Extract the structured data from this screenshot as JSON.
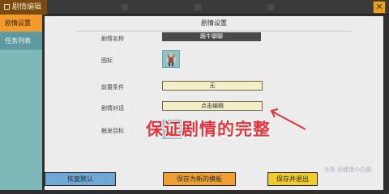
{
  "window": {
    "title": "剧情编辑",
    "close_label": "✕"
  },
  "sidebar": {
    "items": [
      {
        "label": "剧情设置",
        "active": true
      },
      {
        "label": "任务列表",
        "active": false
      }
    ]
  },
  "panel": {
    "header": "剧情设置",
    "fields": {
      "name_label": "剧情名称",
      "name_value": "跟牛聊聊",
      "icon_label": "图标",
      "precondition_label": "前置条件",
      "precondition_value": "无",
      "dialog_label": "剧情对话",
      "dialog_value": "点击编辑",
      "trigger_label": "触发目标",
      "add_symbol": "+"
    },
    "buttons": {
      "reset": "恢复默认",
      "save_template": "保存为新的模板",
      "save_exit": "保存并退出"
    }
  },
  "annotation": "保证剧情的完整",
  "watermark": "头条 @建造小白酱",
  "colors": {
    "annotation": "#e8323a",
    "sidebar_active": "#f39a2a",
    "sidebar_bg": "#7fb8b8",
    "button_blue": "#6fa8d6",
    "button_orange": "#f0a030",
    "button_yellow": "#f2cc2a"
  }
}
